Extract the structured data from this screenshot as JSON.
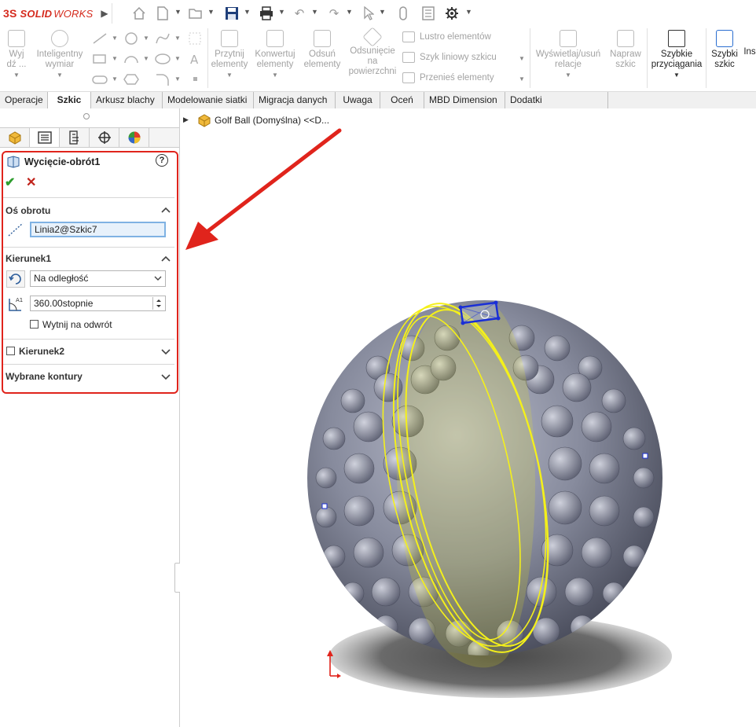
{
  "app": {
    "logo_prefix": "3S",
    "logo_solid": "SOLID",
    "logo_works": "WORKS"
  },
  "ribbon": {
    "btn_exit": "Wyj\ndź ...",
    "btn_smart_dim": "Inteligentny\nwymiar",
    "btn_trim": "Przytnij\nelementy",
    "btn_convert": "Konwertuj\nelementy",
    "btn_offset": "Odsuń\nelementy",
    "btn_offset_surface": "Odsunięcie\nna\npowierzchni",
    "list_mirror": "Lustro elementów",
    "list_linear_pattern": "Szyk liniowy szkicu",
    "list_move": "Przenieś elementy",
    "btn_display_relations": "Wyświetlaj/usuń\nrelacje",
    "btn_repair": "Napraw\nszkic",
    "btn_quick_snaps": "Szybkie\nprzyciągania",
    "btn_rapid_sketch": "Szybki\nszkic",
    "btn_instant": "Ins"
  },
  "tabs": [
    "Operacje",
    "Szkic",
    "Arkusz blachy",
    "Modelowanie siatki",
    "Migracja danych",
    "Uwaga",
    "Oceń",
    "MBD Dimension",
    "Dodatki SOLIDWORKS"
  ],
  "active_tab": "Szkic",
  "panel": {
    "title": "Wycięcie-obrót1",
    "help": "?",
    "ok": "✔",
    "cancel": "✕",
    "axis_section": "Oś obrotu",
    "axis_value": "Linia2@Szkic7",
    "dir1_section": "Kierunek1",
    "dir1_type": "Na odległość",
    "dir1_angle": "360.00stopnie",
    "dir1_reverse_label": "Wytnij na odwrót",
    "dir2_section": "Kierunek2",
    "contours_section": "Wybrane kontury"
  },
  "tree": {
    "root_label": "Golf Ball  (Domyślna) <<D..."
  },
  "colors": {
    "annotation_red": "#e0241c",
    "sketch_yellow": "#f4f01a",
    "sketch_blue": "#1a2fd6",
    "ball": "#7f8497"
  },
  "icons": [
    "home-icon",
    "new-file-icon",
    "open-icon",
    "save-icon",
    "print-icon",
    "undo-icon",
    "redo-icon",
    "select-icon",
    "options-icon"
  ]
}
